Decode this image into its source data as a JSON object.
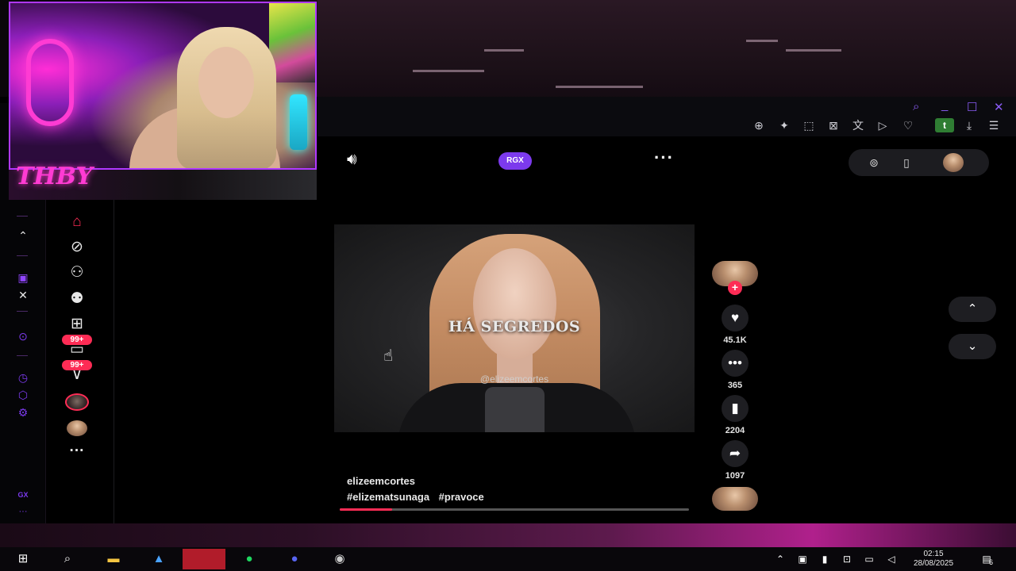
{
  "streamer": {
    "tag": "THBY"
  },
  "browser": {
    "window_controls": {
      "search": "⌕",
      "minimize": "_",
      "maximize": "☐",
      "close": "✕"
    },
    "toolbar_icons": [
      "zoom-in-icon",
      "pin-icon",
      "snapshot-icon",
      "block-icon",
      "translate-icon",
      "send-icon",
      "heart-icon",
      "extension-t-icon",
      "download-icon",
      "menu-icon"
    ],
    "extension_label": "t"
  },
  "gx_sidebar": {
    "label": "GX",
    "more": "···"
  },
  "tiktok": {
    "top": {
      "badge": "RGX",
      "more": "···"
    },
    "nav": {
      "messages_badge": "99+",
      "activity_badge": "99+",
      "more": "···"
    },
    "video": {
      "caption": "HÁ SEGREDOS",
      "watermark": "@elizeemcortes",
      "author": "elizeemcortes",
      "hashtags": [
        "#elizematsunaga",
        "#pravoce"
      ],
      "progress": 0.15
    },
    "actions": {
      "likes": "45.1K",
      "comments": "365",
      "saves": "2204",
      "shares": "1097"
    }
  },
  "taskbar": {
    "time": "02:15",
    "date": "28/08/2025",
    "notification_count": "6"
  },
  "colors": {
    "accent": "#fe2c55",
    "gx": "#7c3aed",
    "neon": "#ff3bd3"
  }
}
